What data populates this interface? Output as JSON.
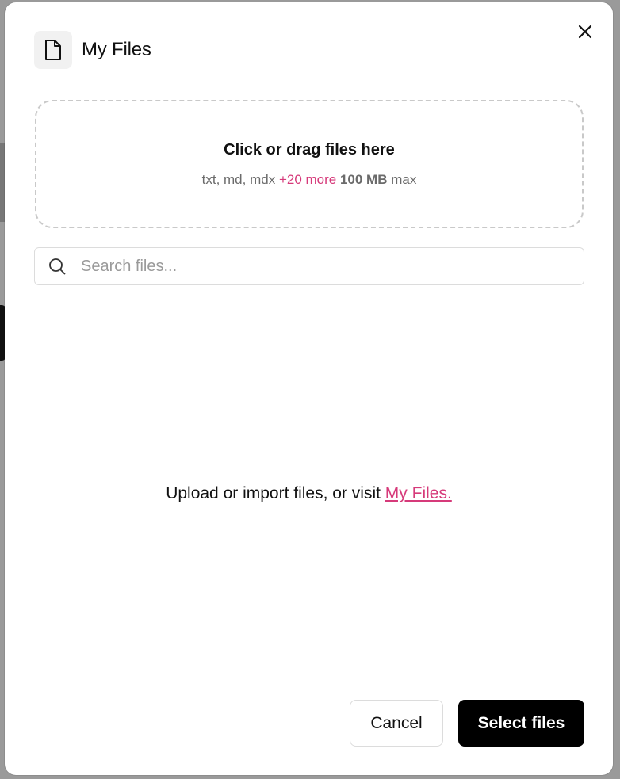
{
  "modal": {
    "title": "My Files",
    "icon": "file-icon",
    "close_icon": "close-icon"
  },
  "dropzone": {
    "title": "Click or drag files here",
    "types": "txt, md, mdx",
    "more_link": "+20 more",
    "size": "100 MB",
    "size_suffix": "max"
  },
  "search": {
    "placeholder": "Search files...",
    "value": "",
    "icon": "search-icon"
  },
  "empty": {
    "text": "Upload or import files, or visit",
    "link": "My Files."
  },
  "footer": {
    "cancel_label": "Cancel",
    "select_label": "Select files"
  },
  "colors": {
    "accent": "#d63a7a",
    "primary_button": "#000000"
  }
}
